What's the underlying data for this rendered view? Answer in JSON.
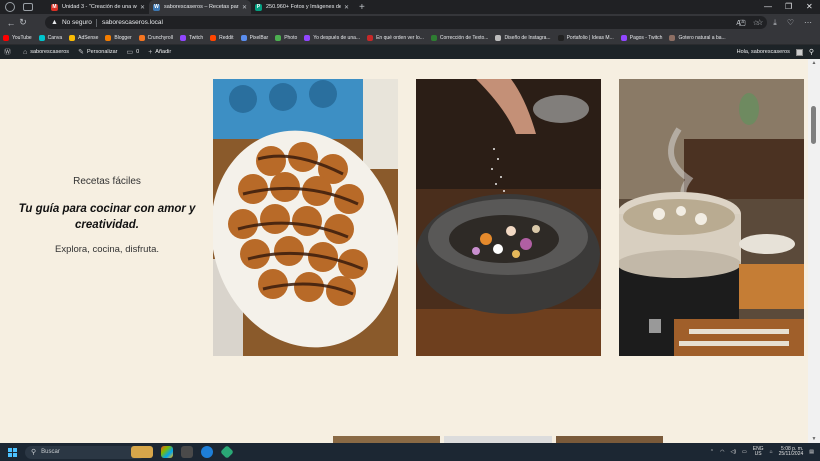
{
  "browser": {
    "tabs": [
      {
        "title": "Unidad 3 - \"Creación de una web",
        "favicon_color": "#d93025",
        "favicon_glyph": "M",
        "active": false
      },
      {
        "title": "saborescaseros – Recetas para co",
        "favicon_color": "#3c78b4",
        "favicon_glyph": "W",
        "active": true
      },
      {
        "title": "250.960+ Fotos y Imágenes de S",
        "favicon_color": "#05a081",
        "favicon_glyph": "P",
        "active": false
      }
    ],
    "address": {
      "security_label": "No seguro",
      "url": "saborescaseros.local"
    },
    "bookmarks": [
      {
        "label": "YouTube",
        "color": "#ff0000"
      },
      {
        "label": "Canva",
        "color": "#00c4cc"
      },
      {
        "label": "AdSense",
        "color": "#fbbc04"
      },
      {
        "label": "Blogger",
        "color": "#f57d00"
      },
      {
        "label": "Crunchyroll",
        "color": "#f47521"
      },
      {
        "label": "Twitch",
        "color": "#9146ff"
      },
      {
        "label": "Reddit",
        "color": "#ff4500"
      },
      {
        "label": "PixelBar",
        "color": "#5a8dee"
      },
      {
        "label": "Photo",
        "color": "#4caf50"
      },
      {
        "label": "Yo después de una...",
        "color": "#9146ff"
      },
      {
        "label": "En qué orden ver lo...",
        "color": "#c62828"
      },
      {
        "label": "Corrección de Texto...",
        "color": "#2e7d32"
      },
      {
        "label": "Diseño de Instagra...",
        "color": "#bdbdbd"
      },
      {
        "label": "Portafolio | Ideas M...",
        "color": "#212121"
      },
      {
        "label": "Pagos - Twitch",
        "color": "#9146ff"
      },
      {
        "label": "Gotero natural a ba...",
        "color": "#8d6e63"
      }
    ]
  },
  "adminbar": {
    "site_name": "saborescaseros",
    "customize": "Personalizar",
    "comments_count": "0",
    "add_new": "Añadir",
    "greeting": "Hola, saborescaseros"
  },
  "hero": {
    "kicker": "Recetas fáciles",
    "tagline": "Tu guía para cocinar con amor y creatividad.",
    "subline": "Explora, cocina, disfruta."
  },
  "taskbar": {
    "search_placeholder": "Buscar",
    "lang_top": "ENG",
    "lang_bottom": "US",
    "time": "5:08 p. m.",
    "date": "25/11/2024"
  }
}
